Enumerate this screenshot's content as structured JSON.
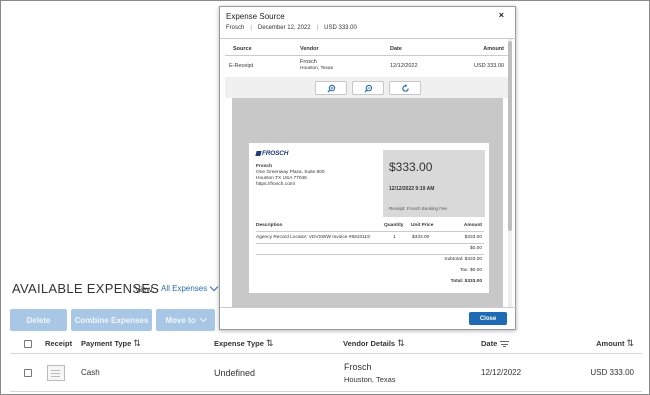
{
  "page": {
    "title": "AVAILABLE EXPENSES",
    "view_label": "View:",
    "view_value": "All Expenses"
  },
  "toolbar": {
    "delete_label": "Delete",
    "combine_label": "Combine Expenses",
    "move_label": "Move to"
  },
  "table": {
    "headers": {
      "receipt": "Receipt",
      "payment_type": "Payment Type",
      "expense_type": "Expense Type",
      "vendor_details": "Vendor Details",
      "date": "Date",
      "amount": "Amount"
    },
    "rows": [
      {
        "payment_type": "Cash",
        "expense_type": "Undefined",
        "vendor_name": "Frosch",
        "vendor_location": "Houston, Texas",
        "date": "12/12/2022",
        "amount": "USD 333.00"
      }
    ]
  },
  "modal": {
    "title": "Expense Source",
    "close_symbol": "×",
    "sub_vendor": "Frosch",
    "sub_date": "December 12, 2022",
    "sub_amount": "USD 333.00",
    "source_table": {
      "headers": {
        "source": "Source",
        "vendor": "Vendor",
        "date": "Date",
        "amount": "Amount"
      },
      "row": {
        "source": "E-Receipt",
        "vendor_name": "Frosch",
        "vendor_location": "Houston, Texas",
        "date": "12/12/2022",
        "amount": "USD 333.00"
      }
    },
    "close_label": "Close"
  },
  "receipt": {
    "logo": "FROSCH",
    "company": "Frosch",
    "address1": "One Greenway Plaza, Suite 800",
    "address2": "Houston TX USA 77046",
    "website": "https://frosch.com/",
    "total_big": "$333.00",
    "datetime": "12/12/2022 9:19 AM",
    "receipt_desc": "Receipt: Frosch Booking Fee",
    "headers": {
      "description": "Description",
      "quantity": "Quantity",
      "unit_price": "Unit Price",
      "amount": "Amount"
    },
    "line": {
      "description": "Agency Record Locator: VDVSWW Invoice #6810119",
      "quantity": "1",
      "unit_price": "$333.00",
      "amount": "$333.00"
    },
    "zero_line": "$0.00",
    "subtotal": "Subtotal: $333.00",
    "tax": "Tax: $0.00",
    "total": "Total: $333.00"
  },
  "colors": {
    "accent": "#1e6ab3",
    "link": "#2b6cb0",
    "disabled_button": "#a8c7e6",
    "logo": "#1f3d7a"
  }
}
